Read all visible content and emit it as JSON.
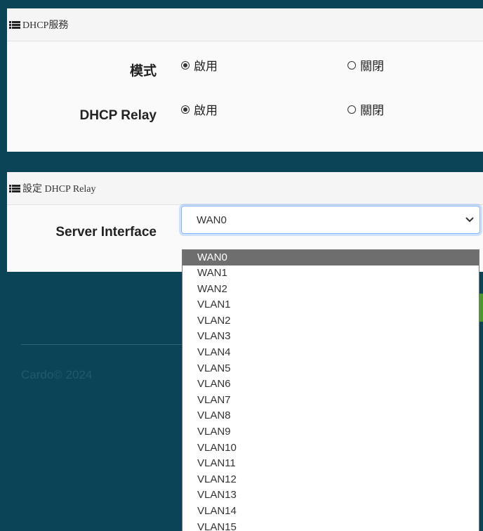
{
  "dhcp_panel": {
    "title": "DHCP服務",
    "mode": {
      "label": "模式",
      "enable": "啟用",
      "disable": "關閉",
      "selected": "enable"
    },
    "relay": {
      "label": "DHCP Relay",
      "enable": "啟用",
      "disable": "關閉",
      "selected": "enable"
    }
  },
  "relay_panel": {
    "title": "設定 DHCP Relay",
    "server_interface": {
      "label": "Server Interface",
      "value": "WAN0"
    }
  },
  "footer": {
    "copyright": "Cardo© 2024"
  },
  "dropdown": {
    "options": [
      "WAN0",
      "WAN1",
      "WAN2",
      "VLAN1",
      "VLAN2",
      "VLAN3",
      "VLAN4",
      "VLAN5",
      "VLAN6",
      "VLAN7",
      "VLAN8",
      "VLAN9",
      "VLAN10",
      "VLAN11",
      "VLAN12",
      "VLAN13",
      "VLAN14",
      "VLAN15"
    ],
    "highlighted": "WAN0"
  },
  "colors": {
    "background": "#0b4456",
    "accent_green": "#4a9a2b",
    "highlight": "#6e6e6e"
  }
}
